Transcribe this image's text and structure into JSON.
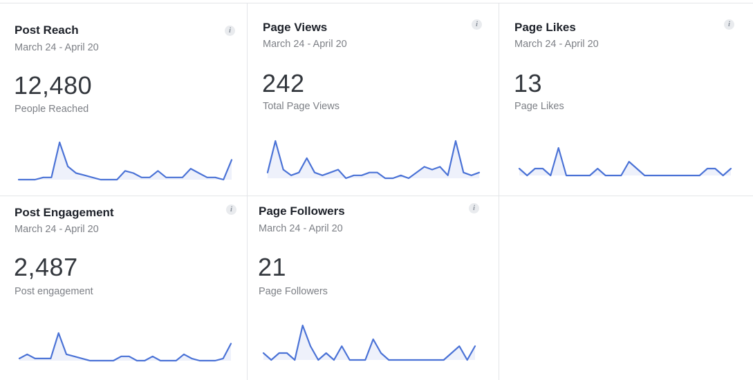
{
  "colors": {
    "line": "#4a72d6",
    "area": "#eef1fb",
    "divider": "#e3e5e8"
  },
  "cards": [
    {
      "title": "Post Reach",
      "date_range": "March 24 - April 20",
      "value": "12,480",
      "value_label": "People Reached",
      "info_icon": "info-icon"
    },
    {
      "title": "Page Views",
      "date_range": "March 24 - April 20",
      "value": "242",
      "value_label": "Total Page Views",
      "info_icon": "info-icon"
    },
    {
      "title": "Page Likes",
      "date_range": "March 24 - April 20",
      "value": "13",
      "value_label": "Page Likes",
      "info_icon": "info-icon"
    },
    {
      "title": "Post Engagement",
      "date_range": "March 24 - April 20",
      "value": "2,487",
      "value_label": "Post engagement",
      "info_icon": "info-icon"
    },
    {
      "title": "Page Followers",
      "date_range": "March 24 - April 20",
      "value": "21",
      "value_label": "Page Followers",
      "info_icon": "info-icon"
    }
  ],
  "chart_data": [
    {
      "type": "line",
      "series": [
        {
          "values": [
            1,
            1,
            1,
            2,
            2,
            18,
            7,
            4,
            3,
            2,
            1,
            1,
            1,
            5,
            4,
            2,
            2,
            5,
            2,
            2,
            2,
            6,
            4,
            2,
            2,
            1,
            10
          ]
        }
      ]
    },
    {
      "type": "line",
      "series": [
        {
          "values": [
            6,
            17,
            7,
            5,
            6,
            11,
            6,
            5,
            6,
            7,
            4,
            5,
            5,
            6,
            6,
            4,
            4,
            5,
            4,
            6,
            8,
            7,
            8,
            5,
            17,
            6,
            5,
            6
          ]
        }
      ]
    },
    {
      "type": "line",
      "series": [
        {
          "values": [
            2,
            1,
            2,
            2,
            1,
            5,
            1,
            1,
            1,
            1,
            2,
            1,
            1,
            1,
            3,
            2,
            1,
            1,
            1,
            1,
            1,
            1,
            1,
            1,
            2,
            2,
            1,
            2
          ]
        }
      ]
    },
    {
      "type": "line",
      "series": [
        {
          "values": [
            3,
            5,
            3,
            3,
            3,
            15,
            5,
            4,
            3,
            2,
            2,
            2,
            2,
            4,
            4,
            2,
            2,
            4,
            2,
            2,
            2,
            5,
            3,
            2,
            2,
            2,
            3,
            10
          ]
        }
      ]
    },
    {
      "type": "line",
      "series": [
        {
          "values": [
            2,
            1,
            2,
            2,
            1,
            6,
            3,
            1,
            2,
            1,
            3,
            1,
            1,
            1,
            4,
            2,
            1,
            1,
            1,
            1,
            1,
            1,
            1,
            1,
            2,
            3,
            1,
            3
          ]
        }
      ]
    }
  ]
}
